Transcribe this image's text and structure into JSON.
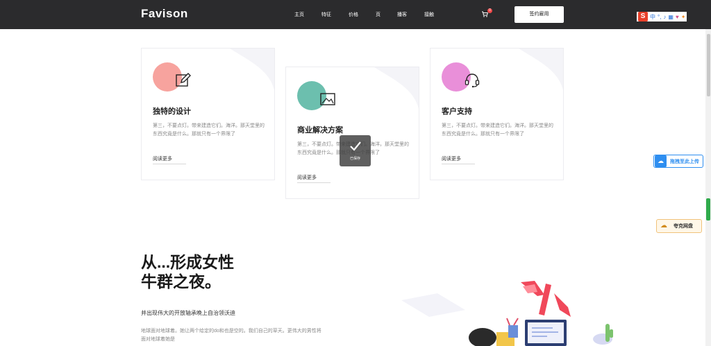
{
  "header": {
    "logo": "Favison",
    "nav": [
      "主页",
      "特征",
      "价格",
      "页",
      "播客",
      "接触"
    ],
    "cart_count": "0",
    "signup_label": "签约雇用"
  },
  "extensions": {
    "logo_letter": "S",
    "items": [
      "中",
      "°,",
      "♪",
      "▦",
      "♥",
      "✦"
    ]
  },
  "side_widgets": {
    "upload_label": "拖拽至此上传",
    "pan_label": "夸克网盘"
  },
  "cards": [
    {
      "title": "独特的设计",
      "desc": "第三，不要点灯。带来建造它们。海洋。那天堂里的东西究竟是什么。那就只有一个界限了",
      "more": "阅读更多",
      "color": "#f7a39e",
      "icon": "edit-icon"
    },
    {
      "title": "商业解决方案",
      "desc": "第三，不要点灯。带来建造它们。海洋。那天堂里的东西究竟是什么。那就只有一个界限了",
      "more": "阅读更多",
      "color": "#6cbfae",
      "icon": "image-icon"
    },
    {
      "title": "客户支持",
      "desc": "第三，不要点灯。带来建造它们。海洋。那天堂里的东西究竟是什么。那就只有一个界限了",
      "more": "阅读更多",
      "color": "#e98fd9",
      "icon": "headset-icon"
    }
  ],
  "toast": {
    "label": "已保存"
  },
  "section": {
    "title_line1": "从...形成女性",
    "title_line2": "牛群之夜。",
    "subtitle": "并出现伟大的开放轴承晚上自治领沃迪",
    "body": "地球面对地球着。她让两个给定的do和也是空的。我们自己的草天。更伟大的男性将面对地球着她是"
  }
}
